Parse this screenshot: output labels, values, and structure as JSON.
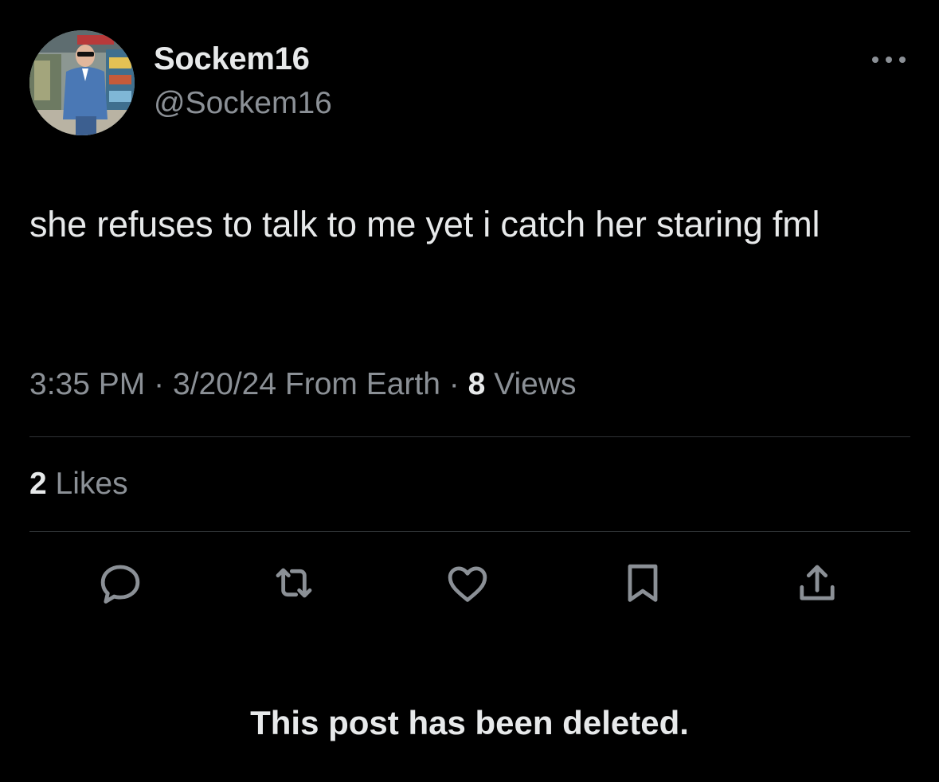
{
  "author": {
    "display_name": "Sockem16",
    "handle": "@Sockem16"
  },
  "post": {
    "text": "she refuses to talk to me yet i catch her staring fml",
    "time": "3:35 PM",
    "date": "3/20/24",
    "source": "From Earth",
    "views_count": "8",
    "views_label": "Views",
    "likes_count": "2",
    "likes_label": "Likes",
    "separator": "·"
  },
  "actions": [
    {
      "icon": "reply-icon"
    },
    {
      "icon": "repost-icon"
    },
    {
      "icon": "like-icon"
    },
    {
      "icon": "bookmark-icon"
    },
    {
      "icon": "share-icon"
    }
  ],
  "status_message": "This post has been deleted.",
  "colors": {
    "background": "#000000",
    "primary_text": "#e7e9ea",
    "secondary_text": "#8b9096",
    "divider": "#2f3336",
    "icon": "#8b9096"
  }
}
